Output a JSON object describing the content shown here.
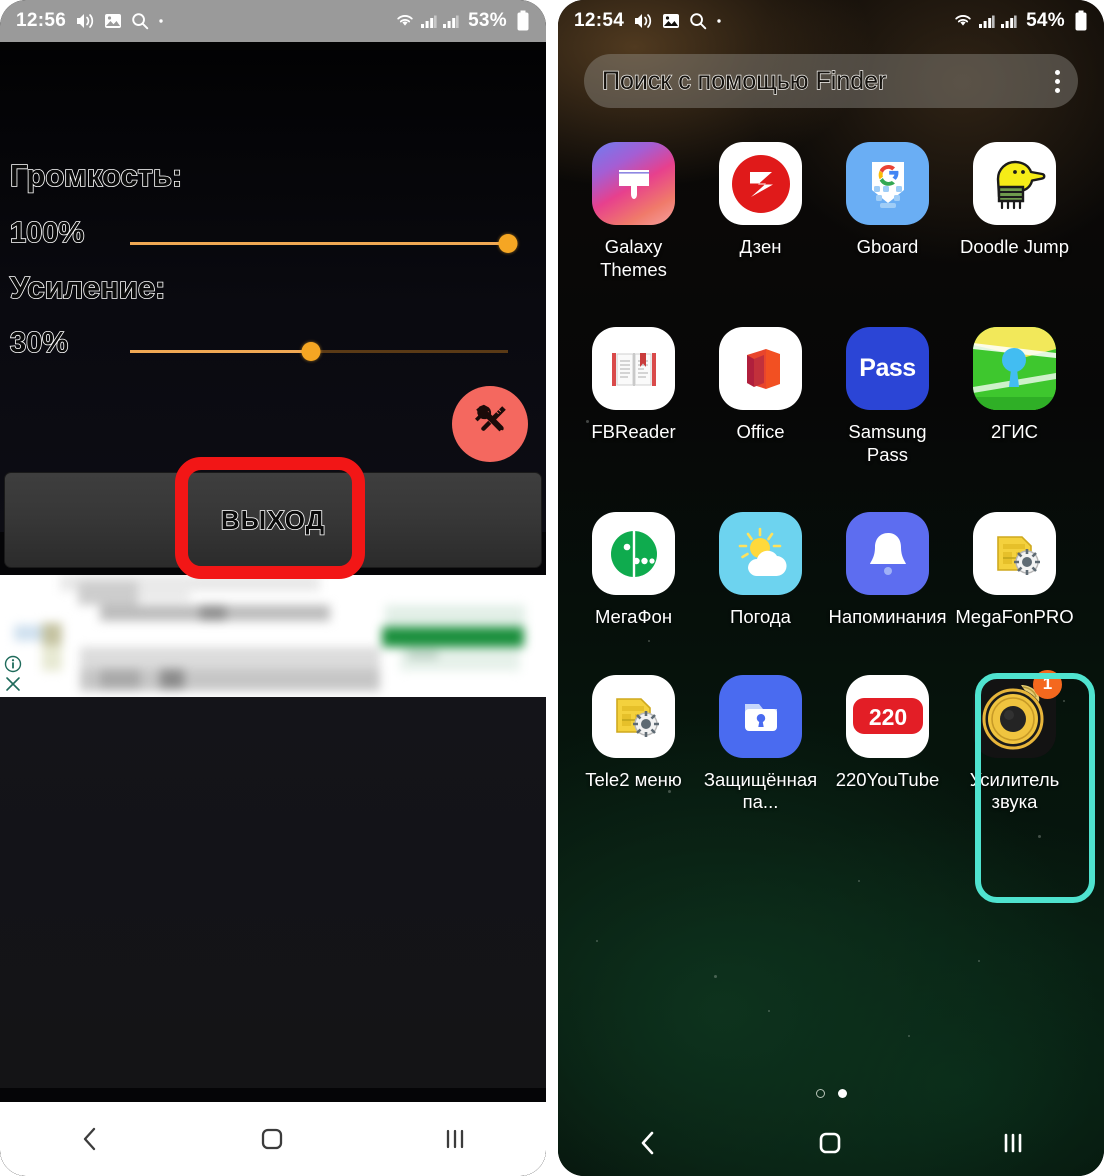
{
  "left_phone": {
    "status_bar": {
      "time": "12:56",
      "battery_percent": "53%",
      "icons": [
        "volume-icon",
        "gallery-icon",
        "search-icon",
        "dot-icon",
        "wifi-icon",
        "signal-icon",
        "signal-icon-2",
        "battery-icon"
      ]
    },
    "app": {
      "volume_label": "Громкость:",
      "volume_value": "100%",
      "volume_percent": 100,
      "gain_label": "Усиление:",
      "gain_value": "30%",
      "gain_percent": 48,
      "settings_icon": "wrench-screwdriver-icon",
      "exit_button": "ВЫХОД",
      "highlight_color": "#f21616",
      "accent_color": "#f5a623"
    },
    "ad": {
      "info_icon": "info-icon",
      "close_icon": "close-icon"
    },
    "nav": {
      "back": "back-icon",
      "home": "home-icon",
      "recents": "recents-icon"
    }
  },
  "right_phone": {
    "status_bar": {
      "time": "12:54",
      "battery_percent": "54%"
    },
    "search": {
      "placeholder": "Поиск с помощью Finder",
      "menu_icon": "kebab-menu-icon"
    },
    "apps": [
      [
        {
          "label": "Galaxy Themes",
          "icon": "galaxy-themes-icon"
        },
        {
          "label": "Дзен",
          "icon": "zen-icon"
        },
        {
          "label": "Gboard",
          "icon": "gboard-icon"
        },
        {
          "label": "Doodle Jump",
          "icon": "doodle-jump-icon"
        }
      ],
      [
        {
          "label": "FBReader",
          "icon": "fbreader-icon"
        },
        {
          "label": "Office",
          "icon": "office-icon"
        },
        {
          "label": "Samsung Pass",
          "icon": "samsung-pass-icon"
        },
        {
          "label": "2ГИС",
          "icon": "2gis-icon"
        }
      ],
      [
        {
          "label": "МегаФон",
          "icon": "megafon-icon"
        },
        {
          "label": "Погода",
          "icon": "weather-icon"
        },
        {
          "label": "Напоминания",
          "icon": "reminders-icon"
        },
        {
          "label": "MegaFonPRO",
          "icon": "megafonpro-icon"
        }
      ],
      [
        {
          "label": "Tele2 меню",
          "icon": "tele2-icon"
        },
        {
          "label": "Защищённая па...",
          "icon": "secure-folder-icon"
        },
        {
          "label": "220YouTube",
          "icon": "220youtube-icon"
        },
        {
          "label": "Усилитель звука",
          "icon": "sound-amplifier-icon",
          "badge": "1",
          "highlighted": true
        }
      ]
    ],
    "highlight_color": "#4fe3cf",
    "page_indicator": {
      "total": 2,
      "active": 2
    },
    "nav": {
      "back": "back-icon",
      "home": "home-icon",
      "recents": "recents-icon"
    }
  }
}
